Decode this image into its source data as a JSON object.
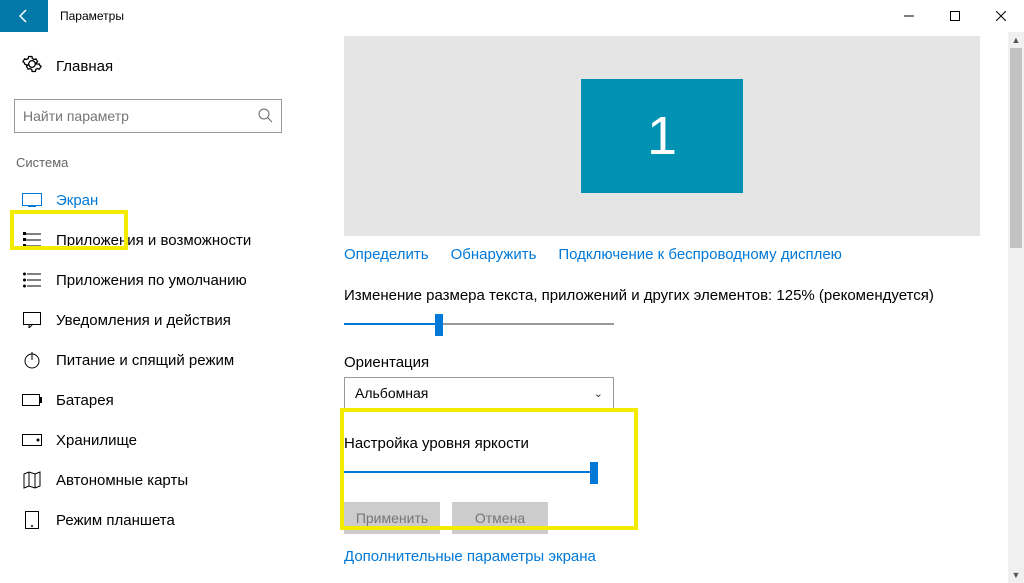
{
  "window": {
    "title": "Параметры"
  },
  "sidebar": {
    "home": "Главная",
    "search_placeholder": "Найти параметр",
    "category": "Система",
    "items": [
      {
        "label": "Экран"
      },
      {
        "label": "Приложения и возможности"
      },
      {
        "label": "Приложения по умолчанию"
      },
      {
        "label": "Уведомления и действия"
      },
      {
        "label": "Питание и спящий режим"
      },
      {
        "label": "Батарея"
      },
      {
        "label": "Хранилище"
      },
      {
        "label": "Автономные карты"
      },
      {
        "label": "Режим планшета"
      }
    ]
  },
  "main": {
    "monitor_number": "1",
    "links": {
      "identify": "Определить",
      "detect": "Обнаружить",
      "wireless": "Подключение к беспроводному дисплею"
    },
    "scale_label": "Изменение размера текста, приложений и других элементов: 125% (рекомендуется)",
    "orientation_label": "Ориентация",
    "orientation_value": "Альбомная",
    "brightness_label": "Настройка уровня яркости",
    "apply": "Применить",
    "cancel": "Отмена",
    "advanced": "Дополнительные параметры экрана"
  }
}
